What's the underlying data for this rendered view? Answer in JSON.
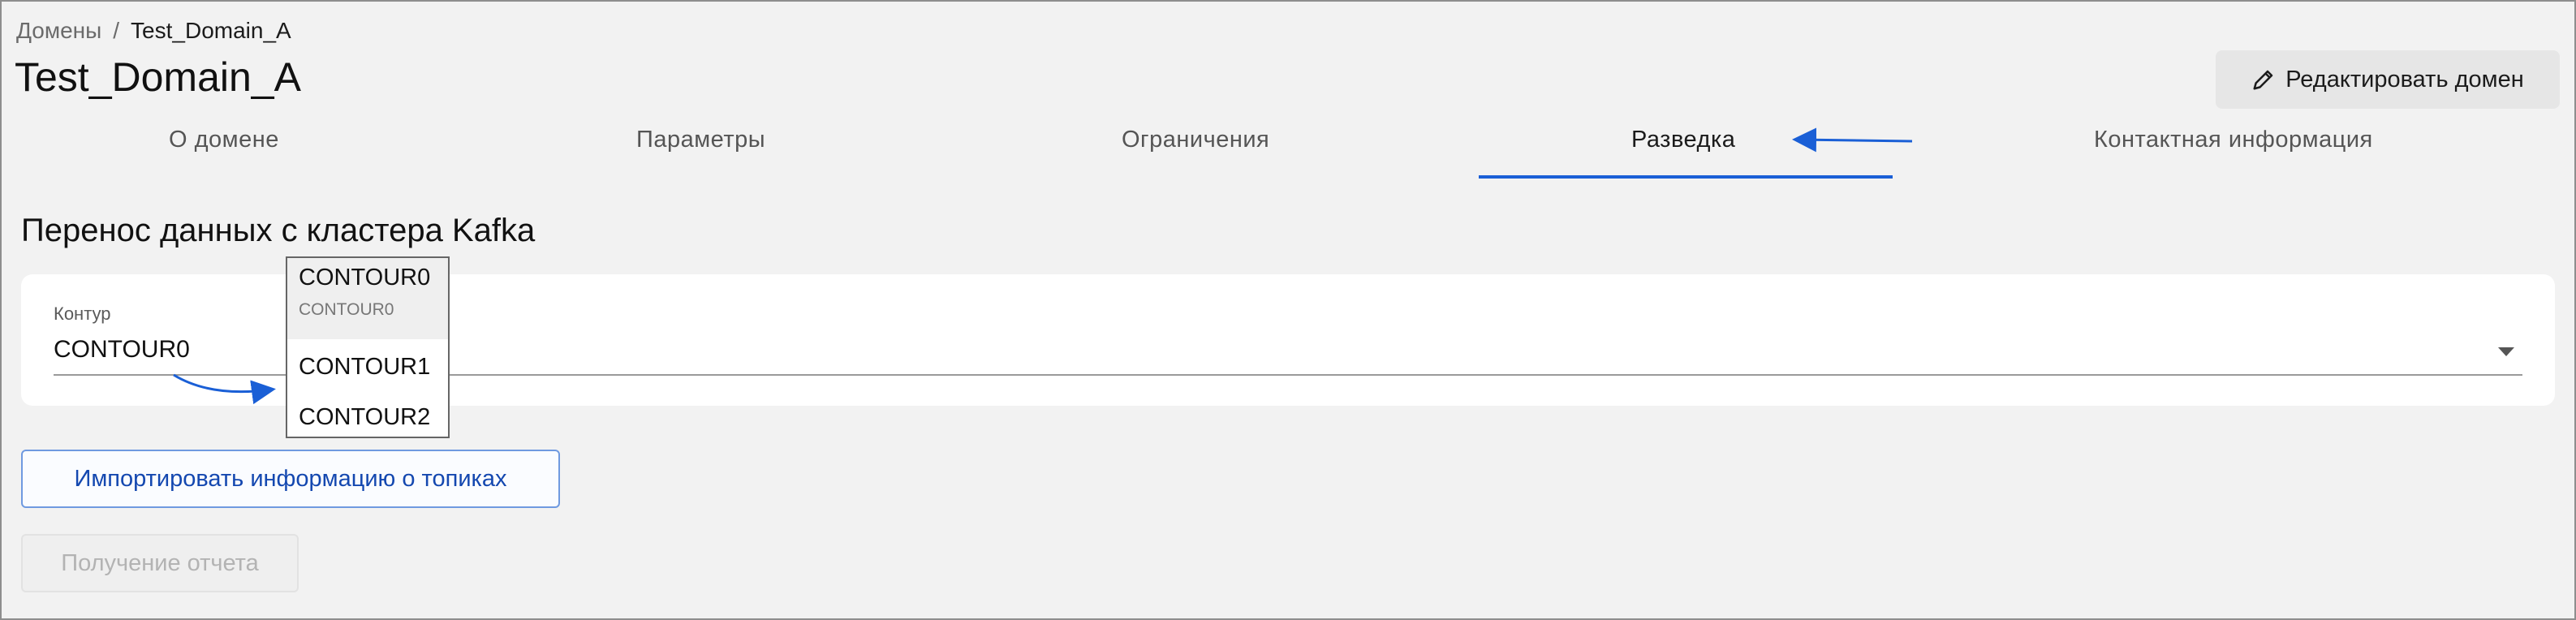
{
  "breadcrumb": {
    "parent": "Домены",
    "separator": "/",
    "current": "Test_Domain_A"
  },
  "page_title": "Test_Domain_A",
  "edit_button": {
    "label": "Редактировать домен",
    "icon": "pencil-icon"
  },
  "tabs": [
    {
      "label": "О домене",
      "active": false
    },
    {
      "label": "Параметры",
      "active": false
    },
    {
      "label": "Ограничения",
      "active": false
    },
    {
      "label": "Разведка",
      "active": true
    },
    {
      "label": "Контактная информация",
      "active": false
    }
  ],
  "section": {
    "title": "Перенос данных с кластера Kafka",
    "contour_field": {
      "label": "Контур",
      "value": "CONTOUR0"
    },
    "dropdown": {
      "options": [
        {
          "label": "CONTOUR0",
          "sublabel": "CONTOUR0",
          "selected": true
        },
        {
          "label": "CONTOUR1"
        },
        {
          "label": "CONTOUR2"
        }
      ]
    },
    "import_button": "Импортировать информацию о топиках",
    "report_button": "Получение отчета"
  },
  "colors": {
    "accent": "#1a5fd6",
    "button_text": "#1448b0",
    "disabled_text": "#b3b3b3"
  }
}
